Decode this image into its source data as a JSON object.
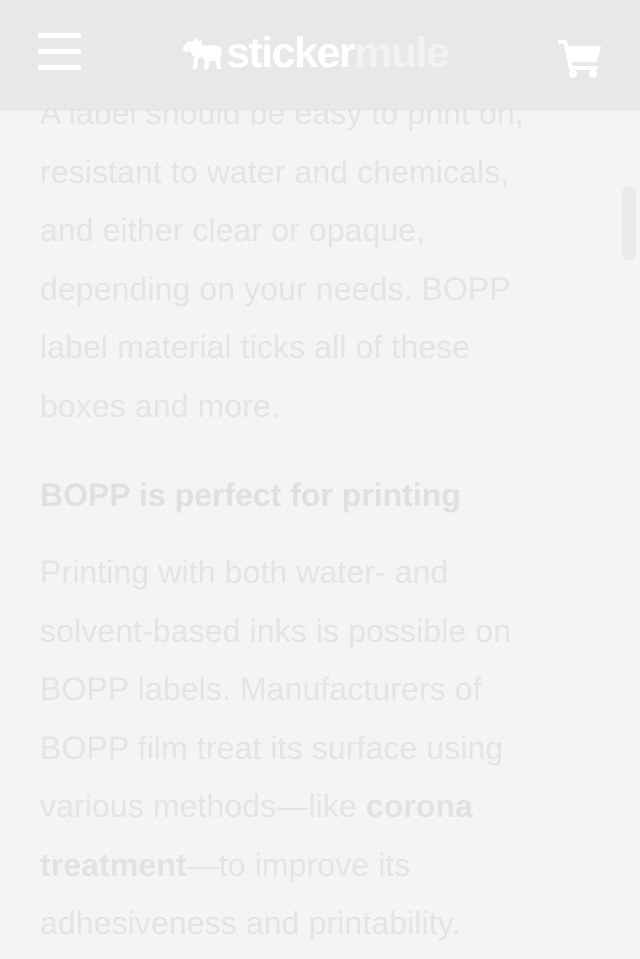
{
  "header": {
    "menu_icon": "hamburger-menu-icon",
    "logo_word_1": "sticker",
    "logo_word_2": "mule",
    "logo_icon": "mule-icon",
    "cart_icon": "shopping-cart-icon"
  },
  "article": {
    "intro_lines": [
      "A label should be easy to print on,",
      "resistant to water and chemicals,",
      "and either clear or opaque,",
      "depending on your needs. BOPP",
      "label material ticks all of these",
      "boxes and more."
    ],
    "section_heading": "BOPP is perfect for printing",
    "body_lines": [
      "Printing with both water- and",
      "solvent-based inks is possible on",
      "BOPP labels. Manufacturers of",
      "BOPP film treat its surface using"
    ],
    "body_line5_text": "various methods—like ",
    "link_part_1": "corona",
    "link_part_2": "treatment",
    "body_line6_rest": "—to improve its",
    "body_line7": "adhesiveness and printability."
  },
  "colors": {
    "header_bg": "#e8e8e8",
    "page_bg": "#f4f4f4",
    "text": "#e4e4e4"
  }
}
